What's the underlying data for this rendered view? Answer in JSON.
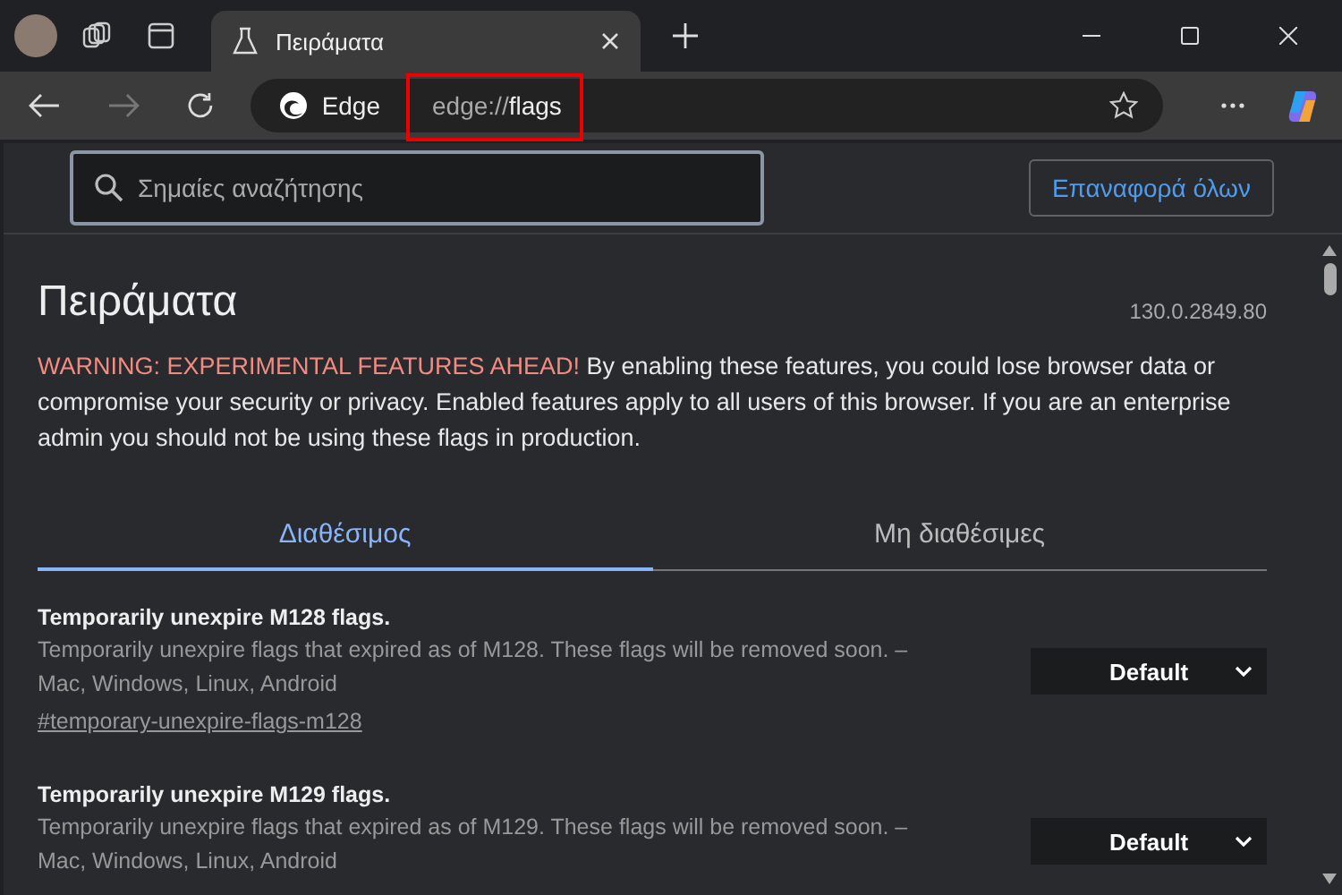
{
  "tab": {
    "title": "Πειράματα"
  },
  "toolbar": {
    "site_label": "Edge",
    "url_scheme": "edge://",
    "url_path": "flags"
  },
  "search": {
    "placeholder": "Σημαίες αναζήτησης"
  },
  "reset_button": "Επαναφορά όλων",
  "page": {
    "title": "Πειράματα",
    "version": "130.0.2849.80",
    "warning": "WARNING: EXPERIMENTAL FEATURES AHEAD!",
    "intro": "By enabling these features, you could lose browser data or compromise your security or privacy. Enabled features apply to all users of this browser. If you are an enterprise admin you should not be using these flags in production."
  },
  "tabs": [
    {
      "label": "Διαθέσιμος",
      "selected": true
    },
    {
      "label": "Μη διαθέσιμες",
      "selected": false
    }
  ],
  "flags": [
    {
      "title": "Temporarily unexpire M128 flags.",
      "description": "Temporarily unexpire flags that expired as of M128. These flags will be removed soon. – Mac, Windows, Linux, Android",
      "link": "#temporary-unexpire-flags-m128",
      "value": "Default"
    },
    {
      "title": "Temporarily unexpire M129 flags.",
      "description": "Temporarily unexpire flags that expired as of M129. These flags will be removed soon. – Mac, Windows, Linux, Android",
      "value": "Default"
    }
  ]
}
